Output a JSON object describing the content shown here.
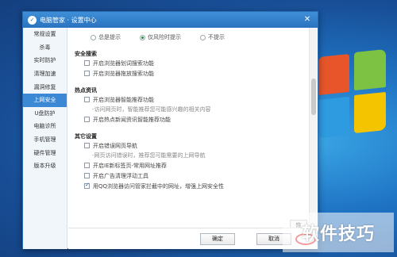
{
  "window": {
    "title": "电脑管家 · 设置中心",
    "logo_glyph": "✓",
    "close_glyph": "✕"
  },
  "sidebar": {
    "items": [
      {
        "label": "常规设置"
      },
      {
        "label": "杀毒"
      },
      {
        "label": "实时防护"
      },
      {
        "label": "清理加速"
      },
      {
        "label": "漏洞修复"
      },
      {
        "label": "上网安全",
        "active": true
      },
      {
        "label": "U盘防护"
      },
      {
        "label": "电脑诊所"
      },
      {
        "label": "手机管理"
      },
      {
        "label": "硬件管理"
      },
      {
        "label": "版本升级"
      }
    ]
  },
  "content": {
    "prompt_options": [
      {
        "label": "总是提示",
        "selected": false
      },
      {
        "label": "仅风险时提示",
        "selected": true
      },
      {
        "label": "不提示",
        "selected": false
      }
    ],
    "safe_search": {
      "title": "安全搜索",
      "items": [
        {
          "label": "开启浏览器划词搜索功能",
          "checked": false
        },
        {
          "label": "开启浏览器拖放搜索功能",
          "checked": false
        }
      ]
    },
    "hot_news": {
      "title": "热点资讯",
      "item1": {
        "label": "开启浏览器智能推荐功能",
        "checked": false
      },
      "desc1": "-访问网页时，智能推荐您可能感兴趣的相关内容",
      "item2": {
        "label": "开启热点新闻资讯智能推荐功能",
        "checked": false
      }
    },
    "other": {
      "title": "其它设置",
      "item1": {
        "label": "开启错误网页导航",
        "checked": false
      },
      "desc1": "-网页访问错误时，推荐您可能需要的上网导航",
      "item2": {
        "label": "开启IE新标签页-常用网址推荐",
        "checked": false
      },
      "item3": {
        "label": "开启广告清理浮动工具",
        "checked": false
      },
      "item4": {
        "label": "用QQ浏览器访问管家拦截中的网址，增强上网安全性",
        "checked": true
      }
    },
    "restore_label": "恢"
  },
  "footer": {
    "ok_label": "确定",
    "cancel_label": "取消"
  },
  "watermark": "软件技巧",
  "colors": {
    "titlebar": "#2b73bf",
    "active_sidebar": "#3b88d4",
    "highlight_circle": "#e02020"
  }
}
